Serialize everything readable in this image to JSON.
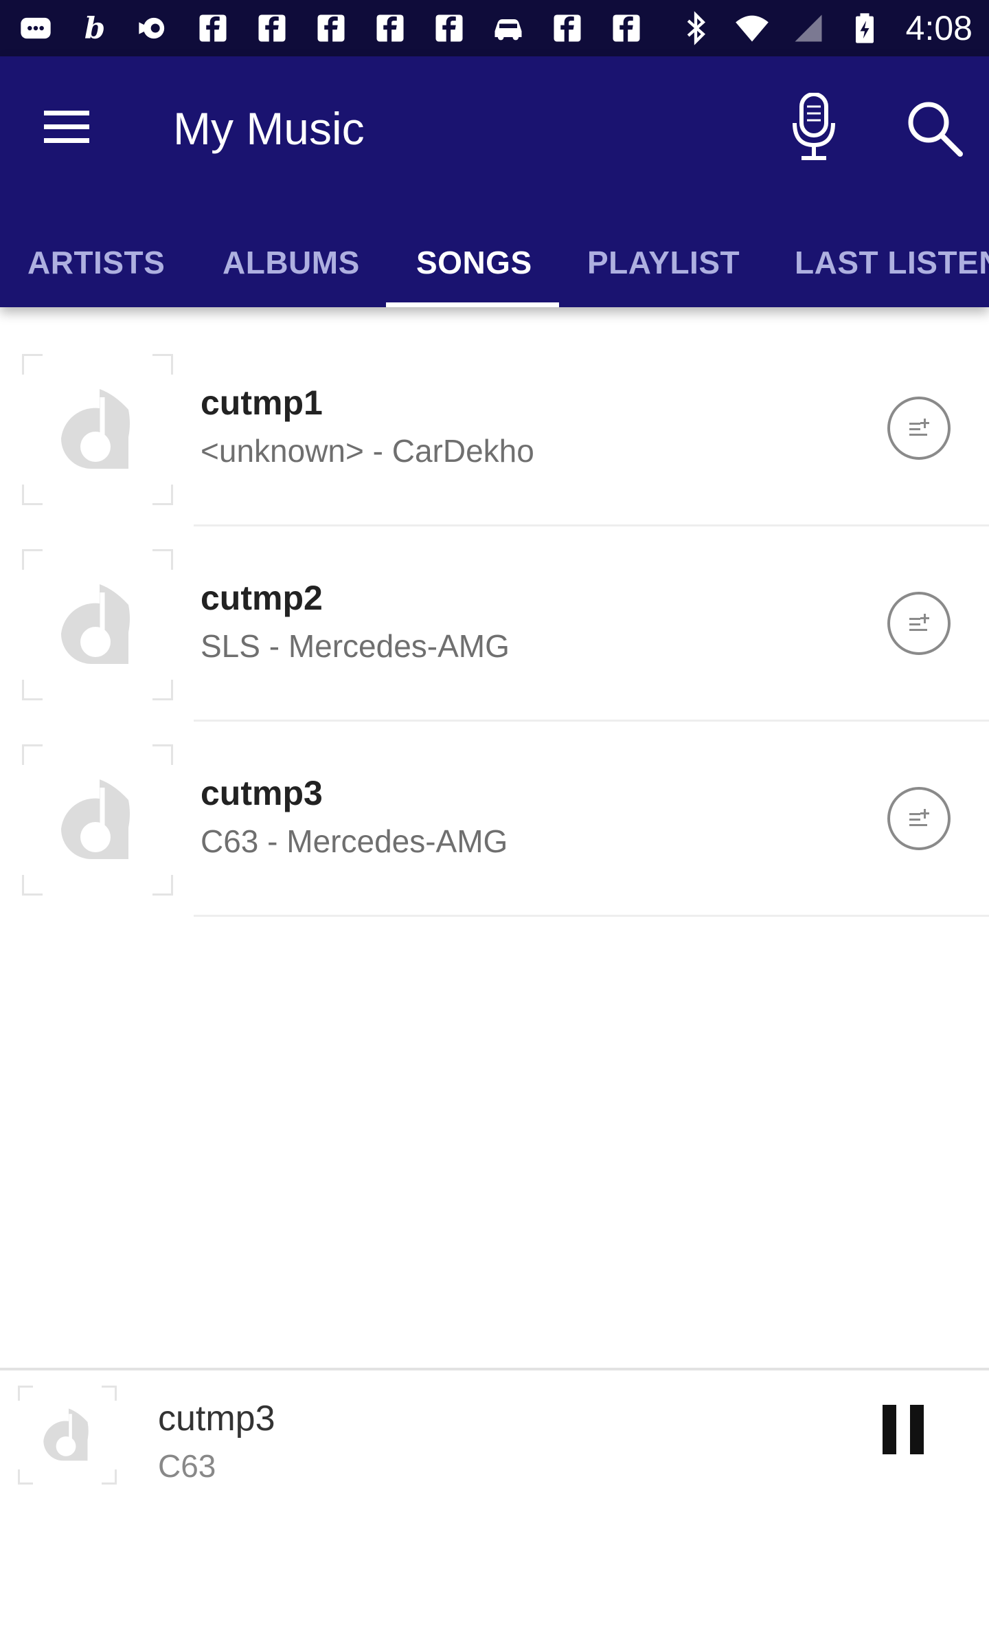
{
  "status_bar": {
    "time": "4:08",
    "left_icons": [
      "message-icon",
      "b-app-icon",
      "brand-icon",
      "facebook-icon",
      "facebook-icon",
      "facebook-icon",
      "facebook-icon",
      "facebook-icon",
      "car-icon",
      "facebook-icon",
      "facebook-icon"
    ],
    "right_icons": [
      "bluetooth-icon",
      "wifi-icon",
      "signal-icon",
      "battery-charging-icon"
    ]
  },
  "app_bar": {
    "title": "My Music",
    "tabs": [
      {
        "label": "ARTISTS",
        "active": false
      },
      {
        "label": "ALBUMS",
        "active": false
      },
      {
        "label": "SONGS",
        "active": true
      },
      {
        "label": "PLAYLIST",
        "active": false
      },
      {
        "label": "LAST LISTEN",
        "active": false
      }
    ]
  },
  "songs": [
    {
      "title": "cutmp1",
      "subtitle": "<unknown> - CarDekho"
    },
    {
      "title": "cutmp2",
      "subtitle": "SLS - Mercedes-AMG"
    },
    {
      "title": "cutmp3",
      "subtitle": "C63 - Mercedes-AMG"
    }
  ],
  "now_playing": {
    "title": "cutmp3",
    "subtitle": "C63"
  },
  "colors": {
    "status_bar": "#0f0c3a",
    "app_bar": "#1a1370",
    "tab_inactive": "#aeb0e0",
    "tab_active": "#ffffff"
  }
}
